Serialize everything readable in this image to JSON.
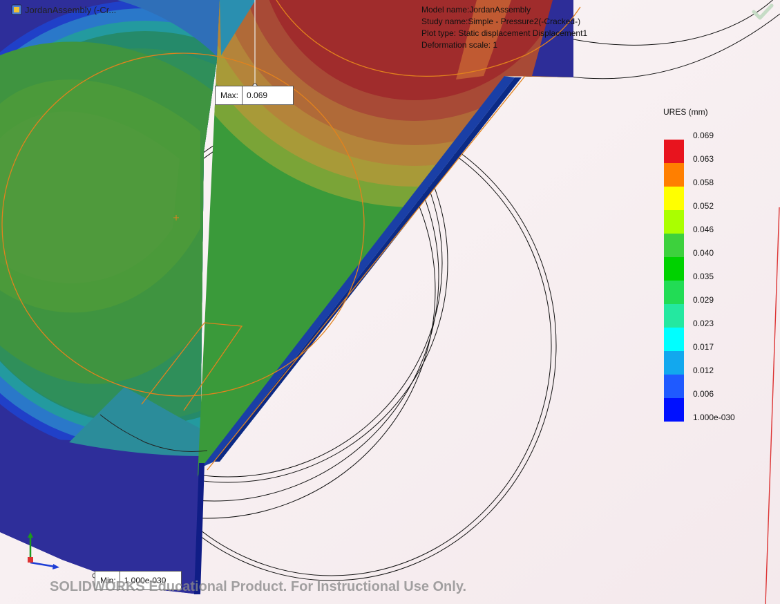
{
  "tree_item": {
    "label": "JordanAssembly  (-Cr...",
    "icon": "assembly-icon"
  },
  "model_info": [
    "Model name:JordanAssembly",
    "Study name:Simple - Pressure2(-Cracked-)",
    "Plot type: Static displacement Displacement1",
    "Deformation scale: 1"
  ],
  "max_callout": {
    "label": "Max:",
    "value": "0.069"
  },
  "min_callout": {
    "label": "Min:",
    "value": "1.000e-030"
  },
  "legend": {
    "title": "URES (mm)",
    "values": [
      "0.069",
      "0.063",
      "0.058",
      "0.052",
      "0.046",
      "0.040",
      "0.035",
      "0.029",
      "0.023",
      "0.017",
      "0.012",
      "0.006",
      "1.000e-030"
    ],
    "colors": [
      "#e8141e",
      "#ff7f00",
      "#ffff00",
      "#aaff00",
      "#3dd13d",
      "#00d200",
      "#22dc55",
      "#24e8a0",
      "#00ffff",
      "#12a8ee",
      "#1f5aff",
      "#0010ff"
    ]
  },
  "watermark": "SOLIDWORKS Educational Product. For Instructional Use Only.",
  "icons": {
    "confirm": "checkmark-icon",
    "triad": "coordinate-triad-icon"
  }
}
